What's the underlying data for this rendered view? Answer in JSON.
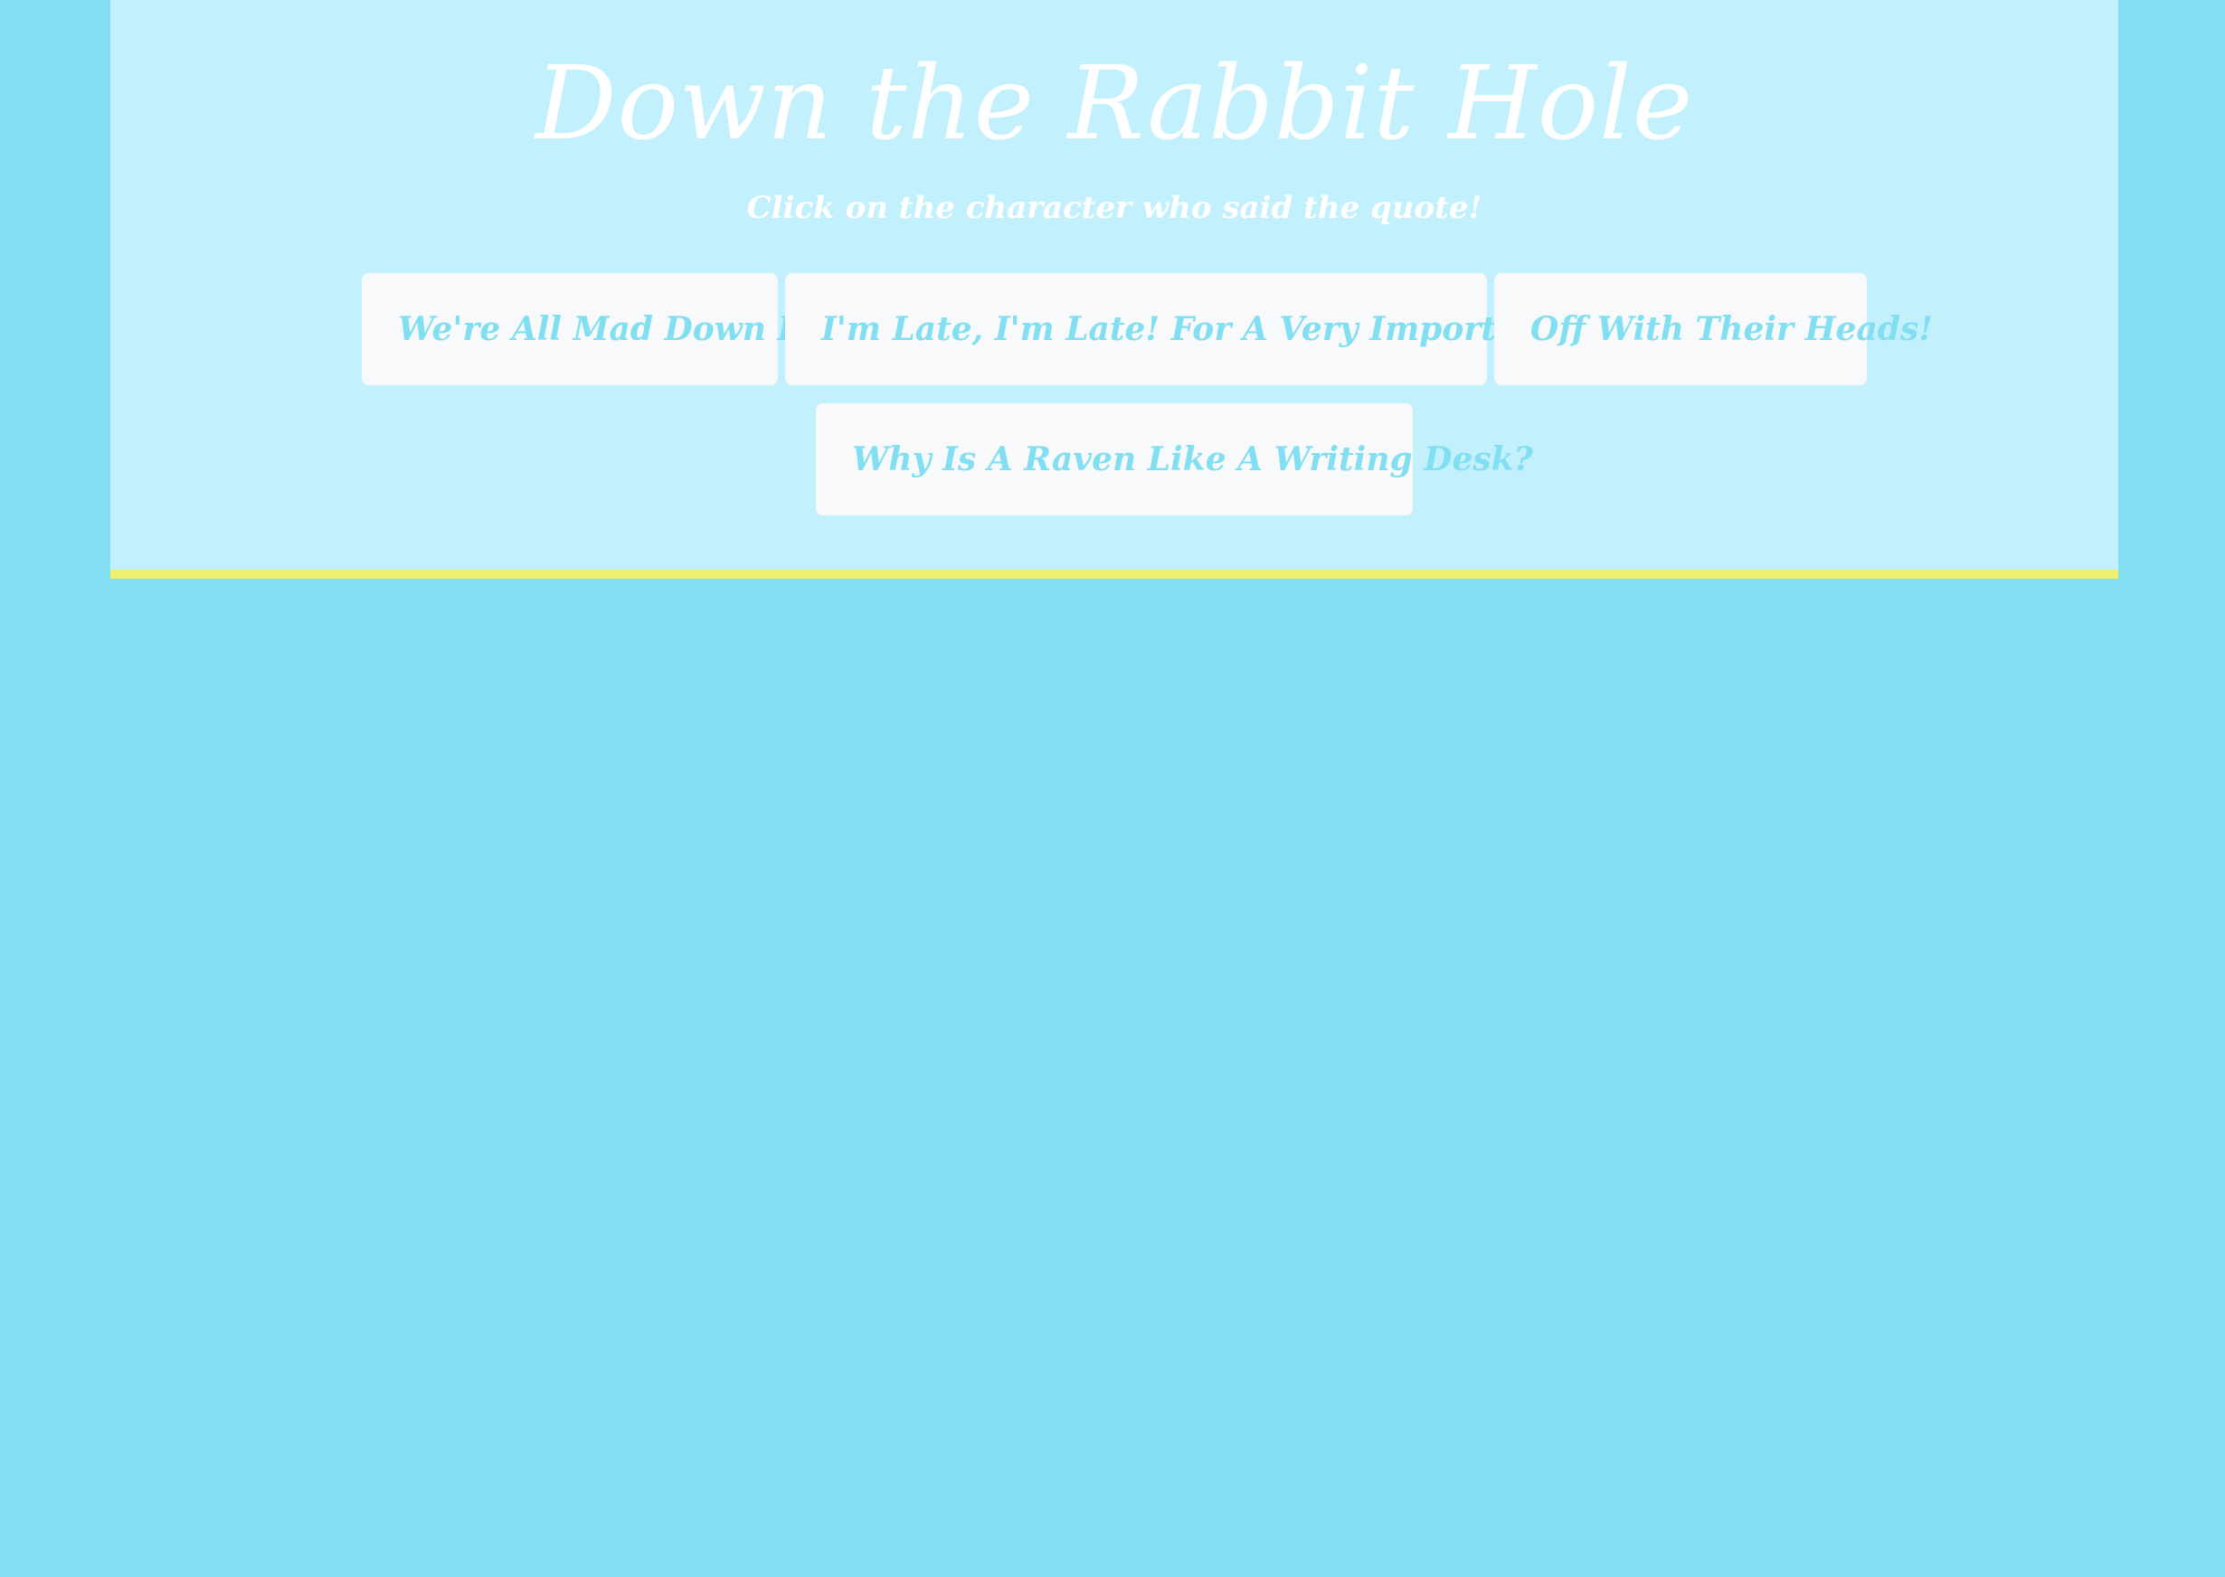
{
  "header": {
    "title": "Down the Rabbit Hole",
    "subtitle": "Click on the character who said the quote!"
  },
  "quotes": [
    {
      "label": "We're All Mad Down Here"
    },
    {
      "label": "I'm Late, I'm Late! For A Very Important Date!"
    },
    {
      "label": "Off With Their Heads!"
    },
    {
      "label": "Why Is A Raven Like A Writing Desk?"
    }
  ],
  "colors": {
    "page_background": "#81dff1",
    "header_background": "#c2f1fd",
    "header_border": "#eeef6e",
    "button_background": "#f8f9fa",
    "button_text": "#81dff1",
    "title_text": "#ffffff"
  }
}
